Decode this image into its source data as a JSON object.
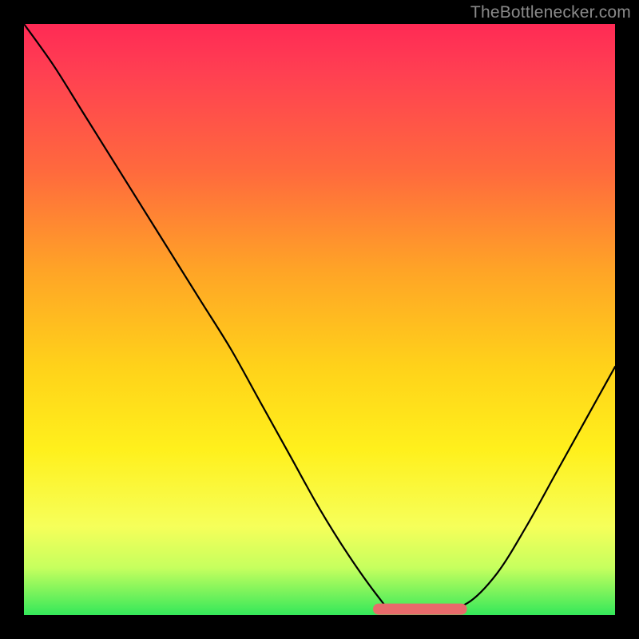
{
  "watermark": {
    "text": "TheBottlenecker.com"
  },
  "chart_data": {
    "type": "line",
    "title": "",
    "xlabel": "",
    "ylabel": "",
    "xlim": [
      0,
      100
    ],
    "ylim": [
      0,
      100
    ],
    "series": [
      {
        "name": "bottleneck-curve",
        "x": [
          0,
          5,
          10,
          15,
          20,
          25,
          30,
          35,
          40,
          45,
          50,
          55,
          60,
          62,
          65,
          70,
          75,
          80,
          85,
          90,
          95,
          100
        ],
        "values": [
          100,
          93,
          85,
          77,
          69,
          61,
          53,
          45,
          36,
          27,
          18,
          10,
          3,
          1,
          1,
          1,
          2,
          7,
          15,
          24,
          33,
          42
        ]
      }
    ],
    "annotations": [
      {
        "name": "optimal-range",
        "x_start": 60,
        "x_end": 74,
        "y": 1
      }
    ],
    "background_gradient": {
      "direction": "top-to-bottom",
      "stops": [
        {
          "pos": 0.0,
          "color": "#ff2a55"
        },
        {
          "pos": 0.25,
          "color": "#ff6a3d"
        },
        {
          "pos": 0.55,
          "color": "#ffd21a"
        },
        {
          "pos": 0.85,
          "color": "#f6ff5a"
        },
        {
          "pos": 1.0,
          "color": "#34e85a"
        }
      ]
    }
  }
}
